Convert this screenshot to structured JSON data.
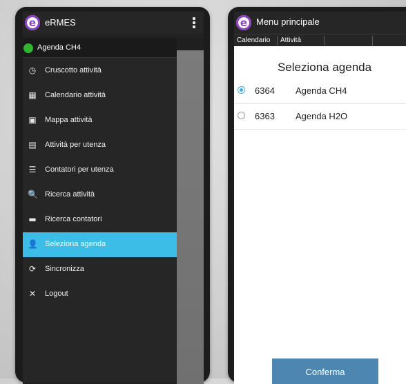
{
  "left_screen": {
    "app_title": "eRMES",
    "logo_letter": "e",
    "current_agenda": "Agenda CH4",
    "menu": [
      {
        "label": "Cruscotto attività",
        "icon": "dashboard-clock-icon",
        "glyph": "◷"
      },
      {
        "label": "Calendario attività",
        "icon": "calendar-icon",
        "glyph": "▦"
      },
      {
        "label": "Mappa attività",
        "icon": "map-icon",
        "glyph": "▣"
      },
      {
        "label": "Attività per utenza",
        "icon": "document-icon",
        "glyph": "▤"
      },
      {
        "label": "Contatori per utenza",
        "icon": "list-icon",
        "glyph": "☰"
      },
      {
        "label": "Ricerca attività",
        "icon": "search-icon",
        "glyph": "🔍"
      },
      {
        "label": "Ricerca contatori",
        "icon": "meter-icon",
        "glyph": "▬"
      },
      {
        "label": "Seleziona agenda",
        "icon": "person-icon",
        "glyph": "👤"
      },
      {
        "label": "Sincronizza",
        "icon": "sync-icon",
        "glyph": "⟳"
      },
      {
        "label": "Logout",
        "icon": "close-icon",
        "glyph": "✕"
      }
    ],
    "active_item": "Seleziona agenda"
  },
  "right_screen": {
    "app_title": "Menu principale",
    "logo_letter": "e",
    "tabs": [
      "Calendario",
      "Attività",
      "",
      ""
    ],
    "dialog": {
      "title": "Seleziona agenda",
      "options": [
        {
          "code": "6364",
          "name": "Agenda CH4",
          "selected": true
        },
        {
          "code": "6363",
          "name": "Agenda H2O",
          "selected": false
        }
      ],
      "confirm_label": "Conferma"
    }
  },
  "colors": {
    "accent_active": "#3cbde8",
    "confirm_button": "#4e86b2",
    "status_green": "#2fb52f",
    "logo_purple": "#8e3fbf"
  }
}
